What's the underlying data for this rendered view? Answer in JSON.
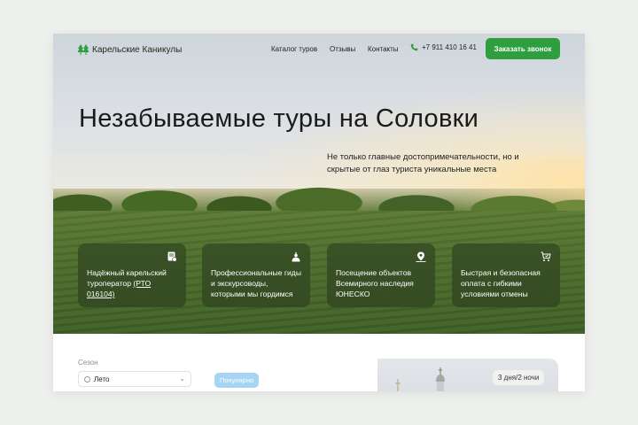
{
  "brand": {
    "name": "Карельские Каникулы",
    "icon": "pine-trees-icon",
    "accent": "#2e9e3f"
  },
  "nav": {
    "items": [
      "Каталог туров",
      "Отзывы",
      "Контакты"
    ],
    "phone": "+7 911 410 16 41",
    "cta": "Заказать звонок"
  },
  "hero": {
    "title": "Незабываемые туры на Соловки",
    "subtitle": "Не только главные достопримечательности, но и скрытые от глаз туриста уникальные места"
  },
  "features": [
    {
      "text": "Надёжный карельский туроператор",
      "link": "(РТО 016104)",
      "icon": "document-check-icon"
    },
    {
      "text": "Профессиональные гиды и экскурсоводы, которыми мы гордимся",
      "icon": "guide-person-icon"
    },
    {
      "text": "Посещение объектов Всемирного наследия ЮНЕСКО",
      "icon": "map-pin-icon"
    },
    {
      "text": "Быстрая и безопасная оплата с гибкими условиями отмены",
      "icon": "cart-check-icon"
    }
  ],
  "filter": {
    "label": "Сезон",
    "value": "Лето"
  },
  "tour": {
    "badge": "Популярно",
    "duration": "3 дня/2 ночи"
  }
}
